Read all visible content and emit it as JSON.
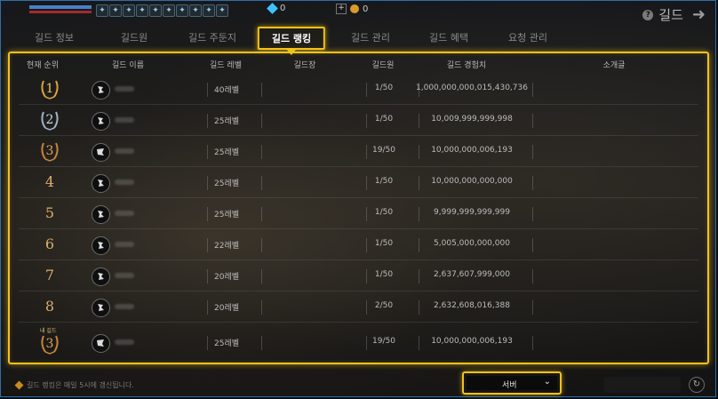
{
  "window": {
    "title": "길드"
  },
  "hud": {
    "gem_count": "0",
    "gold_count": "0"
  },
  "tabs": [
    {
      "label": "길드 정보",
      "active": false
    },
    {
      "label": "길드원",
      "active": false
    },
    {
      "label": "길드 주둔지",
      "active": false
    },
    {
      "label": "길드 랭킹",
      "active": true
    },
    {
      "label": "길드 관리",
      "active": false
    },
    {
      "label": "길드 혜택",
      "active": false
    },
    {
      "label": "요청 관리",
      "active": false
    }
  ],
  "table": {
    "headers": [
      "현재 순위",
      "길드 이름",
      "길드 레벨",
      "길드장",
      "길드원",
      "길드 경험치",
      "소개글"
    ],
    "rows": [
      {
        "rank": "1",
        "level": "40레벨",
        "members": "1/50",
        "exp": "1,000,000,000,015,430,736"
      },
      {
        "rank": "2",
        "level": "25레벨",
        "members": "1/50",
        "exp": "10,009,999,999,998"
      },
      {
        "rank": "3",
        "level": "25레벨",
        "members": "19/50",
        "exp": "10,000,000,006,193"
      },
      {
        "rank": "4",
        "level": "25레벨",
        "members": "1/50",
        "exp": "10,000,000,000,000"
      },
      {
        "rank": "5",
        "level": "25레벨",
        "members": "1/50",
        "exp": "9,999,999,999,999"
      },
      {
        "rank": "6",
        "level": "22레벨",
        "members": "1/50",
        "exp": "5,005,000,000,000"
      },
      {
        "rank": "7",
        "level": "20레벨",
        "members": "1/50",
        "exp": "2,637,607,999,000"
      },
      {
        "rank": "8",
        "level": "20레벨",
        "members": "2/50",
        "exp": "2,632,608,016,388"
      }
    ],
    "my_guild": {
      "badge": "내 길드",
      "rank": "3",
      "level": "25레벨",
      "members": "19/50",
      "exp": "10,000,000,006,193"
    }
  },
  "footer": {
    "note": "길드 랭킹은 매일 5시에 갱신됩니다.",
    "server_select_value": "서버"
  },
  "colors": {
    "highlight": "#f2c21a",
    "gold_laurel": "#d9a441",
    "silver_laurel": "#9fb4c6",
    "bronze_laurel": "#c4843c"
  }
}
